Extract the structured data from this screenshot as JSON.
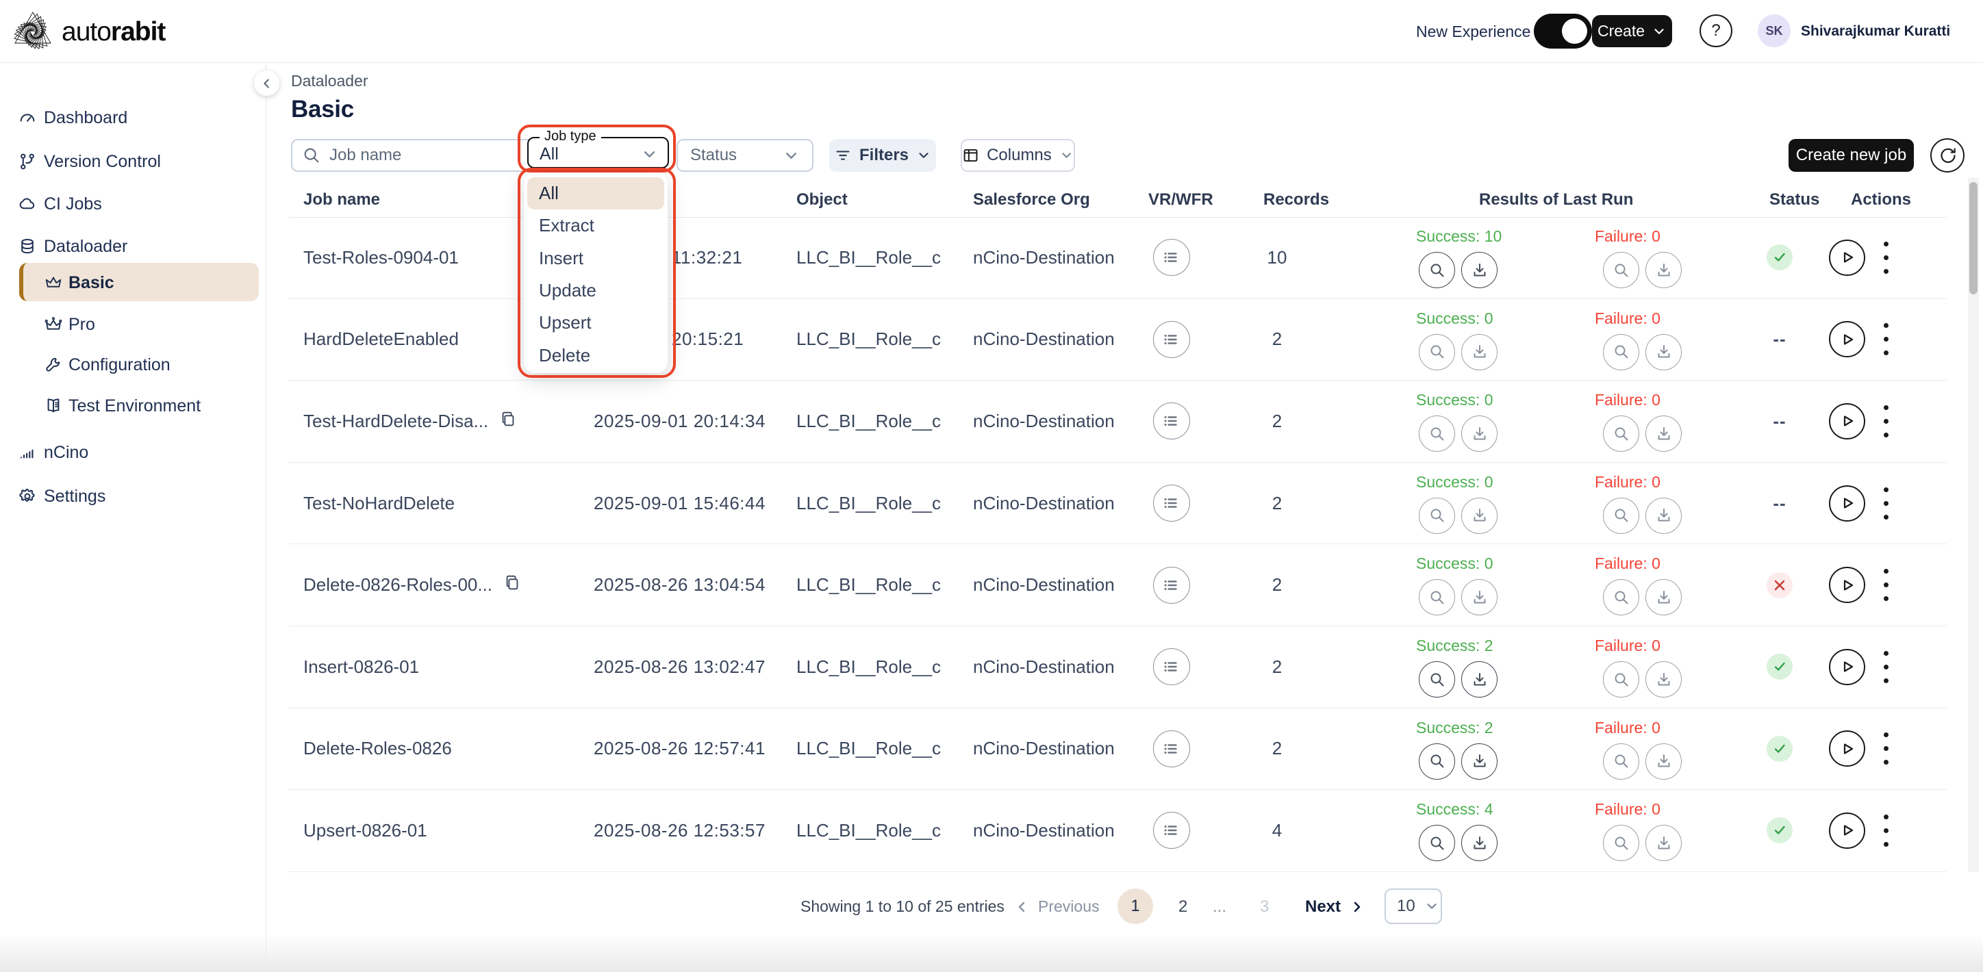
{
  "topbar": {
    "brand_light": "auto",
    "brand_bold": "rabit",
    "new_experience_label": "New Experience",
    "create_label": "Create",
    "help_label": "?",
    "avatar_initials": "SK",
    "user_name": "Shivarajkumar Kuratti"
  },
  "sidebar": {
    "items": [
      {
        "label": "Dashboard",
        "icon": "dashboard",
        "sub": false,
        "selected": false
      },
      {
        "label": "Version Control",
        "icon": "version-control",
        "sub": false,
        "selected": false
      },
      {
        "label": "CI Jobs",
        "icon": "ci-jobs",
        "sub": false,
        "selected": false
      },
      {
        "label": "Dataloader",
        "icon": "dataloader",
        "sub": false,
        "selected": false
      },
      {
        "label": "Basic",
        "icon": "crown-basic",
        "sub": true,
        "selected": true
      },
      {
        "label": "Pro",
        "icon": "crown-pro",
        "sub": true,
        "selected": false
      },
      {
        "label": "Configuration",
        "icon": "wrench",
        "sub": true,
        "selected": false
      },
      {
        "label": "Test Environment",
        "icon": "book",
        "sub": true,
        "selected": false
      },
      {
        "label": "nCino",
        "icon": "bars",
        "sub": false,
        "selected": false
      },
      {
        "label": "Settings",
        "icon": "gear",
        "sub": false,
        "selected": false
      }
    ]
  },
  "breadcrumb": "Dataloader",
  "page_title": "Basic",
  "filter_bar": {
    "search_placeholder": "Job name",
    "job_type_label": "Job type",
    "job_type_value": "All",
    "status_placeholder": "Status",
    "filters_label": "Filters",
    "columns_label": "Columns",
    "create_job_label": "Create new job"
  },
  "job_type_menu": {
    "options": [
      "All",
      "Extract",
      "Insert",
      "Update",
      "Upsert",
      "Delete"
    ],
    "selected": "All"
  },
  "table": {
    "headers": {
      "job_name": "Job name",
      "object": "Object",
      "salesforce_org": "Salesforce Org",
      "vr_wfr": "VR/WFR",
      "records": "Records",
      "results": "Results of Last Run",
      "status": "Status",
      "actions": "Actions"
    },
    "success_prefix": "Success: ",
    "failure_prefix": "Failure: ",
    "rows": [
      {
        "name": "Test-Roles-0904-01",
        "copy": false,
        "date": "11:32:21",
        "time_only": true,
        "object": "LLC_BI__Role__c",
        "org": "nCino-Destination",
        "records": "10",
        "success": 10,
        "failure": 0,
        "status": "success"
      },
      {
        "name": "HardDeleteEnabled",
        "copy": false,
        "date": "20:15:21",
        "time_only": true,
        "object": "LLC_BI__Role__c",
        "org": "nCino-Destination",
        "records": "2",
        "success": 0,
        "failure": 0,
        "status": "none"
      },
      {
        "name": "Test-HardDelete-Disa...",
        "copy": true,
        "date": "2025-09-01 20:14:34",
        "time_only": false,
        "object": "LLC_BI__Role__c",
        "org": "nCino-Destination",
        "records": "2",
        "success": 0,
        "failure": 0,
        "status": "none"
      },
      {
        "name": "Test-NoHardDelete",
        "copy": false,
        "date": "2025-09-01 15:46:44",
        "time_only": false,
        "object": "LLC_BI__Role__c",
        "org": "nCino-Destination",
        "records": "2",
        "success": 0,
        "failure": 0,
        "status": "none"
      },
      {
        "name": "Delete-0826-Roles-00...",
        "copy": true,
        "date": "2025-08-26 13:04:54",
        "time_only": false,
        "object": "LLC_BI__Role__c",
        "org": "nCino-Destination",
        "records": "2",
        "success": 0,
        "failure": 0,
        "status": "failed"
      },
      {
        "name": "Insert-0826-01",
        "copy": false,
        "date": "2025-08-26 13:02:47",
        "time_only": false,
        "object": "LLC_BI__Role__c",
        "org": "nCino-Destination",
        "records": "2",
        "success": 2,
        "failure": 0,
        "status": "success"
      },
      {
        "name": "Delete-Roles-0826",
        "copy": false,
        "date": "2025-08-26 12:57:41",
        "time_only": false,
        "object": "LLC_BI__Role__c",
        "org": "nCino-Destination",
        "records": "2",
        "success": 2,
        "failure": 0,
        "status": "success"
      },
      {
        "name": "Upsert-0826-01",
        "copy": false,
        "date": "2025-08-26 12:53:57",
        "time_only": false,
        "object": "LLC_BI__Role__c",
        "org": "nCino-Destination",
        "records": "4",
        "success": 4,
        "failure": 0,
        "status": "success"
      }
    ]
  },
  "pagination": {
    "summary": "Showing 1 to 10 of 25 entries",
    "previous_label": "Previous",
    "page_1": "1",
    "page_2": "2",
    "ellipsis": "...",
    "page_3": "3",
    "next_label": "Next",
    "page_size": "10"
  },
  "colors": {
    "accent_beige": "#f0e4d8",
    "accent_brown": "#a9731e",
    "annotation_red": "#e8432a",
    "success_green": "#4caf50",
    "failure_red": "#f44336",
    "dark_button": "#121212"
  }
}
